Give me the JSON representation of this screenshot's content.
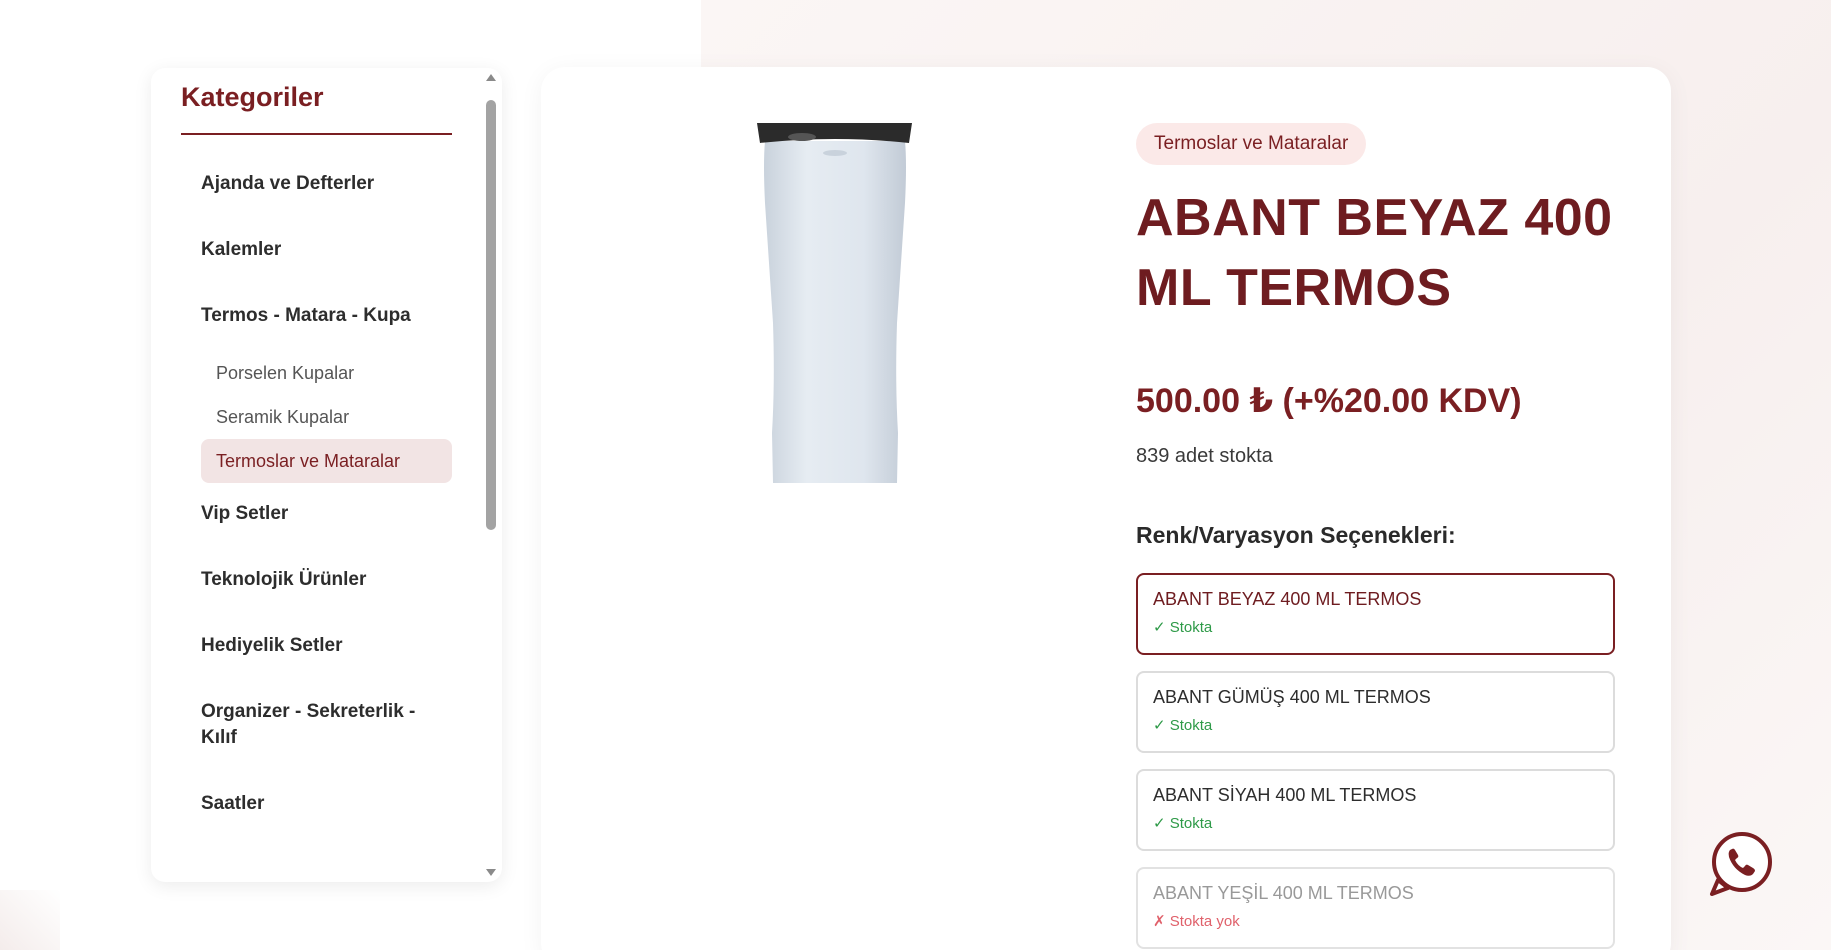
{
  "sidebar": {
    "title": "Kategoriler",
    "categories": [
      {
        "label": "Ajanda ve Defterler"
      },
      {
        "label": "Kalemler"
      },
      {
        "label": "Termos - Matara - Kupa"
      },
      {
        "label": "Vip Setler"
      },
      {
        "label": "Teknolojik Ürünler"
      },
      {
        "label": "Hediyelik Setler"
      },
      {
        "label": "Organizer - Sekreterlik - Kılıf"
      },
      {
        "label": "Saatler"
      }
    ],
    "subcategories": [
      {
        "label": "Porselen Kupalar"
      },
      {
        "label": "Seramik Kupalar"
      },
      {
        "label": "Termoslar ve Mataralar",
        "active": true
      }
    ]
  },
  "product": {
    "category_badge": "Termoslar ve Mataralar",
    "title": "ABANT BEYAZ 400 ML TERMOS",
    "price": "500.00 ₺ (+%20.00 KDV)",
    "stock": "839 adet stokta",
    "image_icon": "thermos-image"
  },
  "variants": {
    "title": "Renk/Varyasyon Seçenekleri:",
    "items": [
      {
        "name": "ABANT BEYAZ 400 ML TERMOS",
        "status": "✓ Stokta",
        "selected": true
      },
      {
        "name": "ABANT GÜMÜŞ 400 ML TERMOS",
        "status": "✓ Stokta"
      },
      {
        "name": "ABANT SİYAH 400 ML TERMOS",
        "status": "✓ Stokta"
      },
      {
        "name": "ABANT YEŞİL 400 ML TERMOS",
        "status": "✗ Stokta yok",
        "out_of_stock": true
      }
    ]
  },
  "floating": {
    "icon": "whatsapp-phone-icon"
  },
  "colors": {
    "brand": "#7a1f22",
    "in_stock": "#2e9a48",
    "out_of_stock": "#e0616b"
  }
}
